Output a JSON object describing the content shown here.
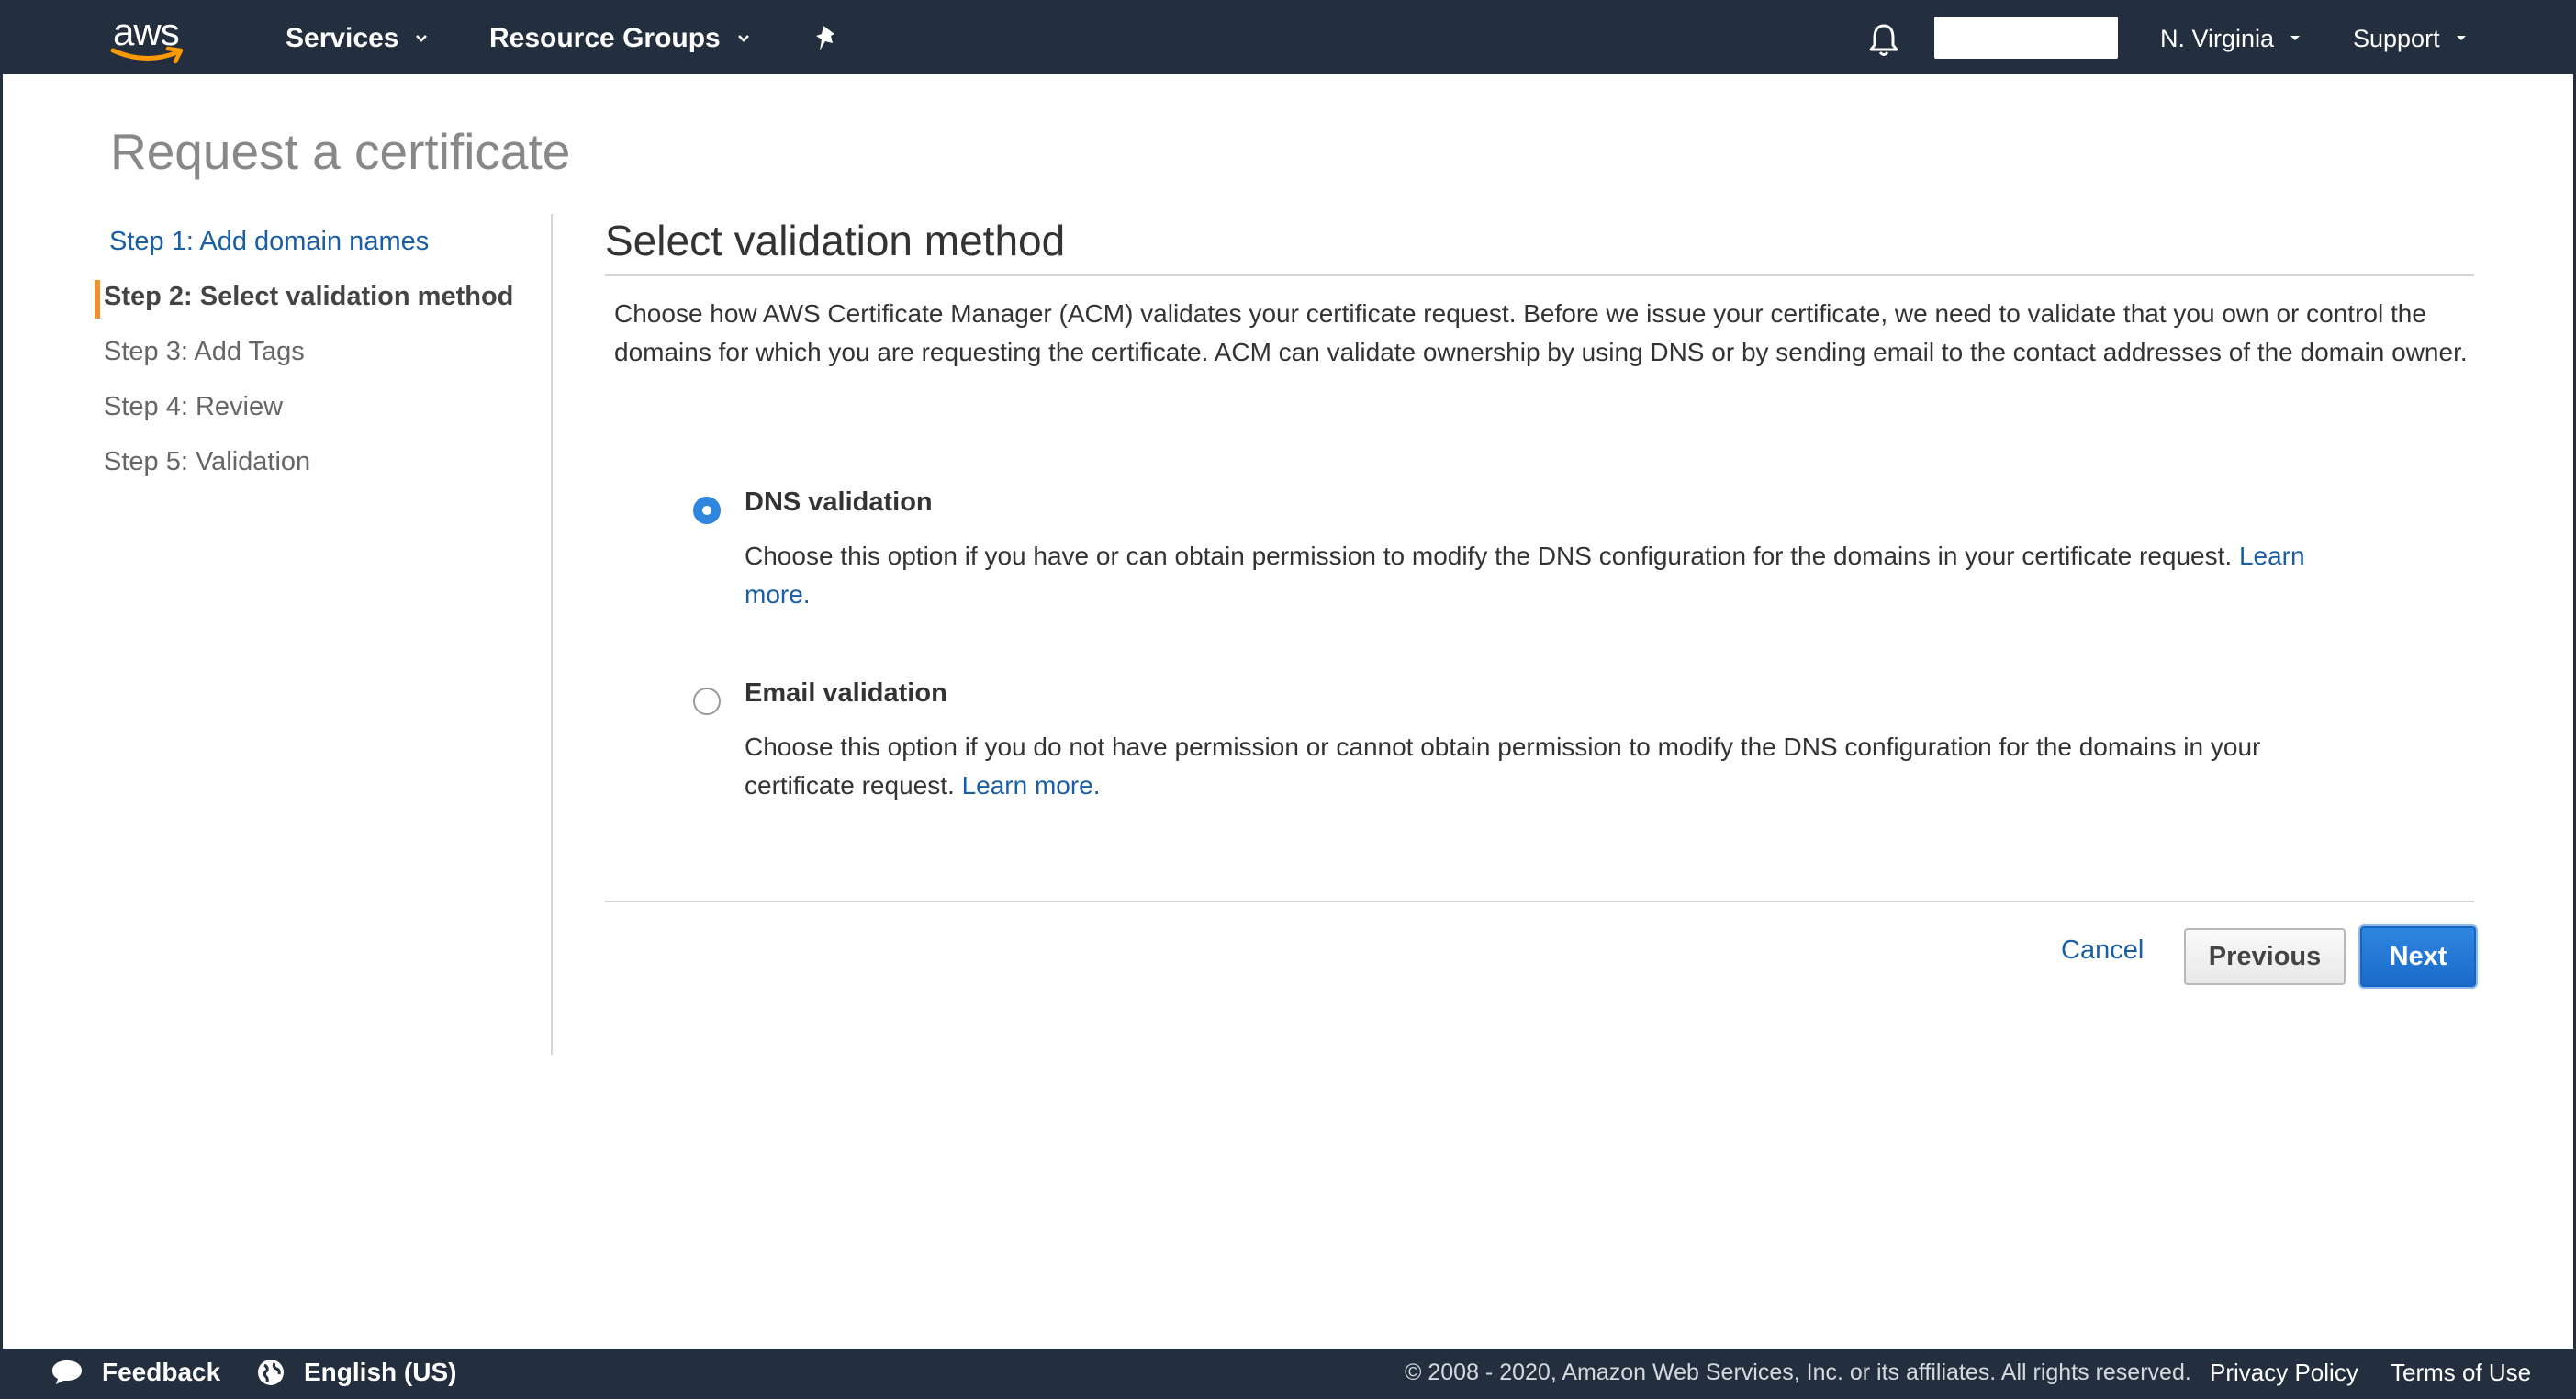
{
  "topnav": {
    "logo_text": "aws",
    "services_label": "Services",
    "resource_groups_label": "Resource Groups",
    "region_label": "N. Virginia",
    "support_label": "Support",
    "icons": [
      "pin-icon",
      "bell-icon",
      "chevron-down-icon"
    ]
  },
  "page": {
    "title": "Request a certificate"
  },
  "steps": [
    {
      "label": "Step 1: Add domain names",
      "state": "link"
    },
    {
      "label": "Step 2: Select validation method",
      "state": "active"
    },
    {
      "label": "Step 3: Add Tags",
      "state": "pending"
    },
    {
      "label": "Step 4: Review",
      "state": "pending"
    },
    {
      "label": "Step 5: Validation",
      "state": "pending"
    }
  ],
  "main": {
    "section_title": "Select validation method",
    "intro": "Choose how AWS Certificate Manager (ACM) validates your certificate request. Before we issue your certificate, we need to validate that you own or control the domains for which you are requesting the certificate. ACM can validate ownership by using DNS or by sending email to the contact addresses of the domain owner.",
    "options": [
      {
        "label": "DNS validation",
        "description": "Choose this option if you have or can obtain permission to modify the DNS configuration for the domains in your certificate request.",
        "link": "Learn more.",
        "selected": true
      },
      {
        "label": "Email validation",
        "description": "Choose this option if you do not have permission or cannot obtain permission to modify the DNS configuration for the domains in your certificate request.",
        "link": "Learn more.",
        "selected": false
      }
    ],
    "cancel_label": "Cancel",
    "previous_label": "Previous",
    "next_label": "Next"
  },
  "footer": {
    "feedback_label": "Feedback",
    "language_label": "English (US)",
    "copyright": "© 2008 - 2020, Amazon Web Services, Inc. or its affiliates. All rights reserved.",
    "privacy_label": "Privacy Policy",
    "terms_label": "Terms of Use"
  },
  "colors": {
    "nav_bg": "#232f3e",
    "link": "#1a5ea6",
    "accent": "#ec912d",
    "primary_button": "#1b6ac9",
    "radio_selected": "#2e86de"
  }
}
